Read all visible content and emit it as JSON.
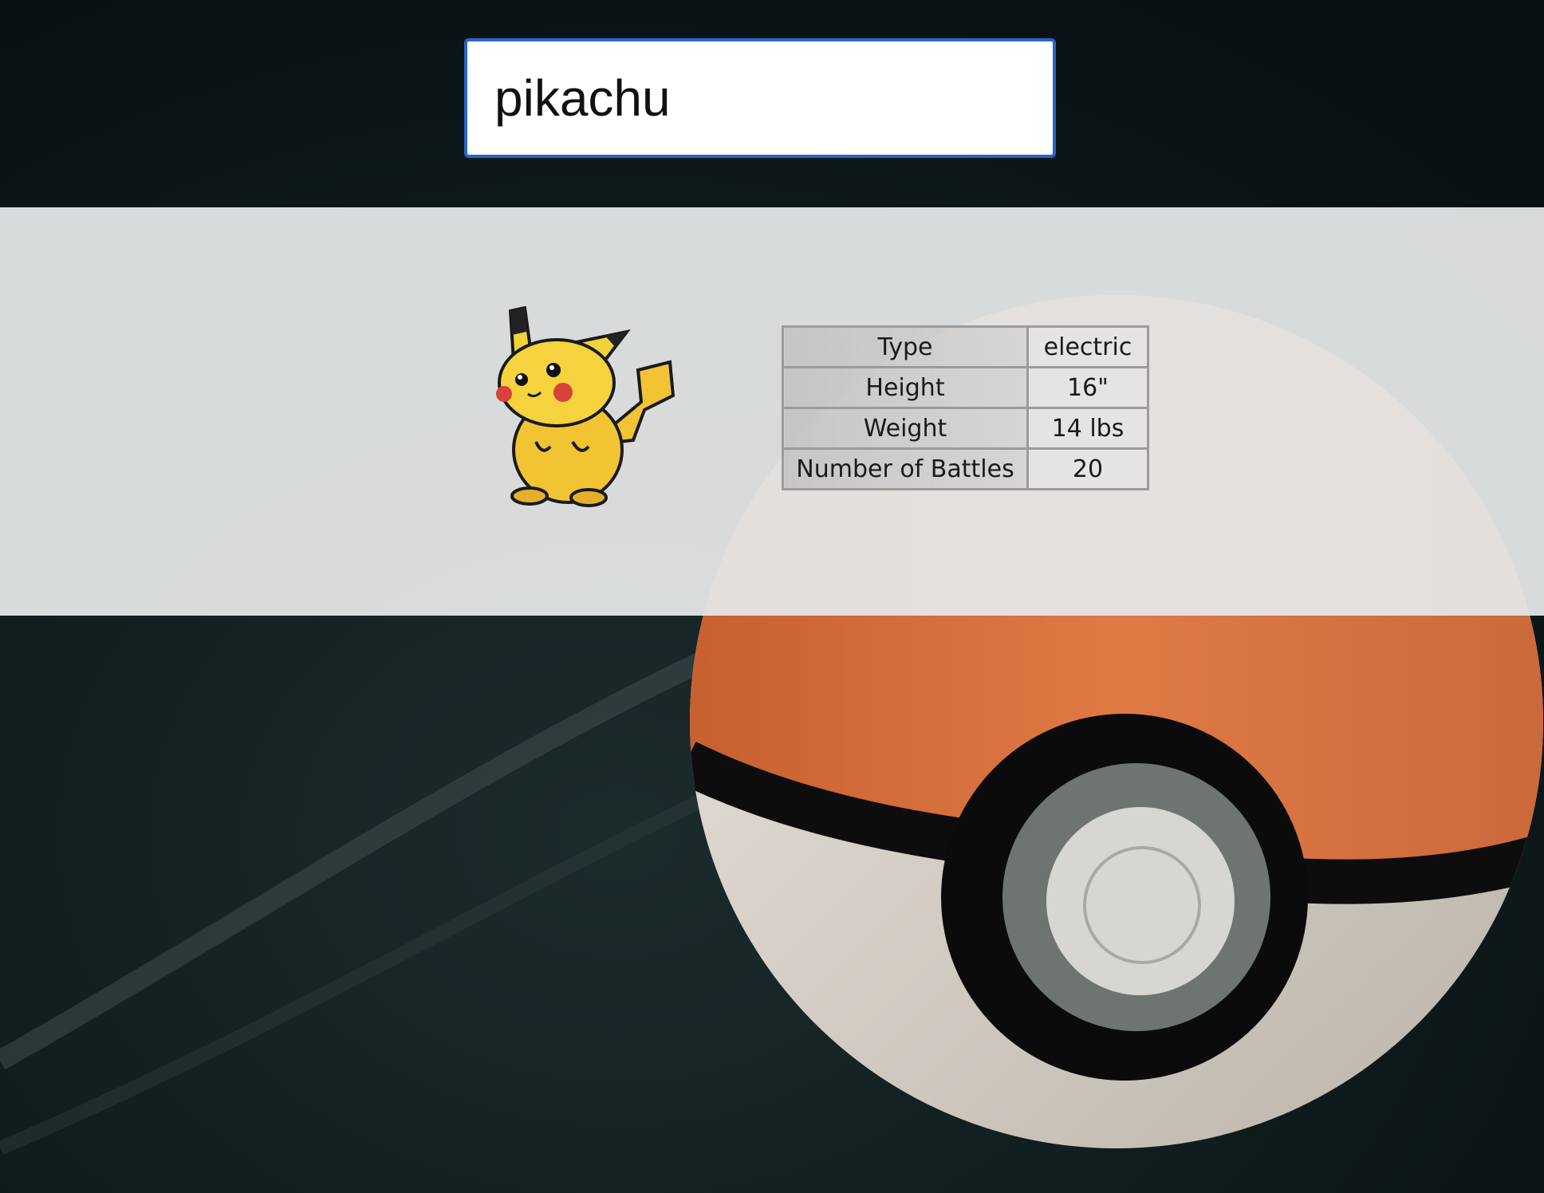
{
  "search": {
    "value": "pikachu",
    "placeholder": ""
  },
  "pokemon": {
    "sprite_icon": "pikachu-sprite"
  },
  "stats": [
    {
      "label": "Type",
      "value": "electric"
    },
    {
      "label": "Height",
      "value": "16\""
    },
    {
      "label": "Weight",
      "value": "14 lbs"
    },
    {
      "label": "Number of Battles",
      "value": "20"
    }
  ],
  "colors": {
    "background": "#0c1617",
    "band": "#e4e6e6",
    "input_border": "#2a64c8",
    "pokeball_red": "#d9703d"
  }
}
